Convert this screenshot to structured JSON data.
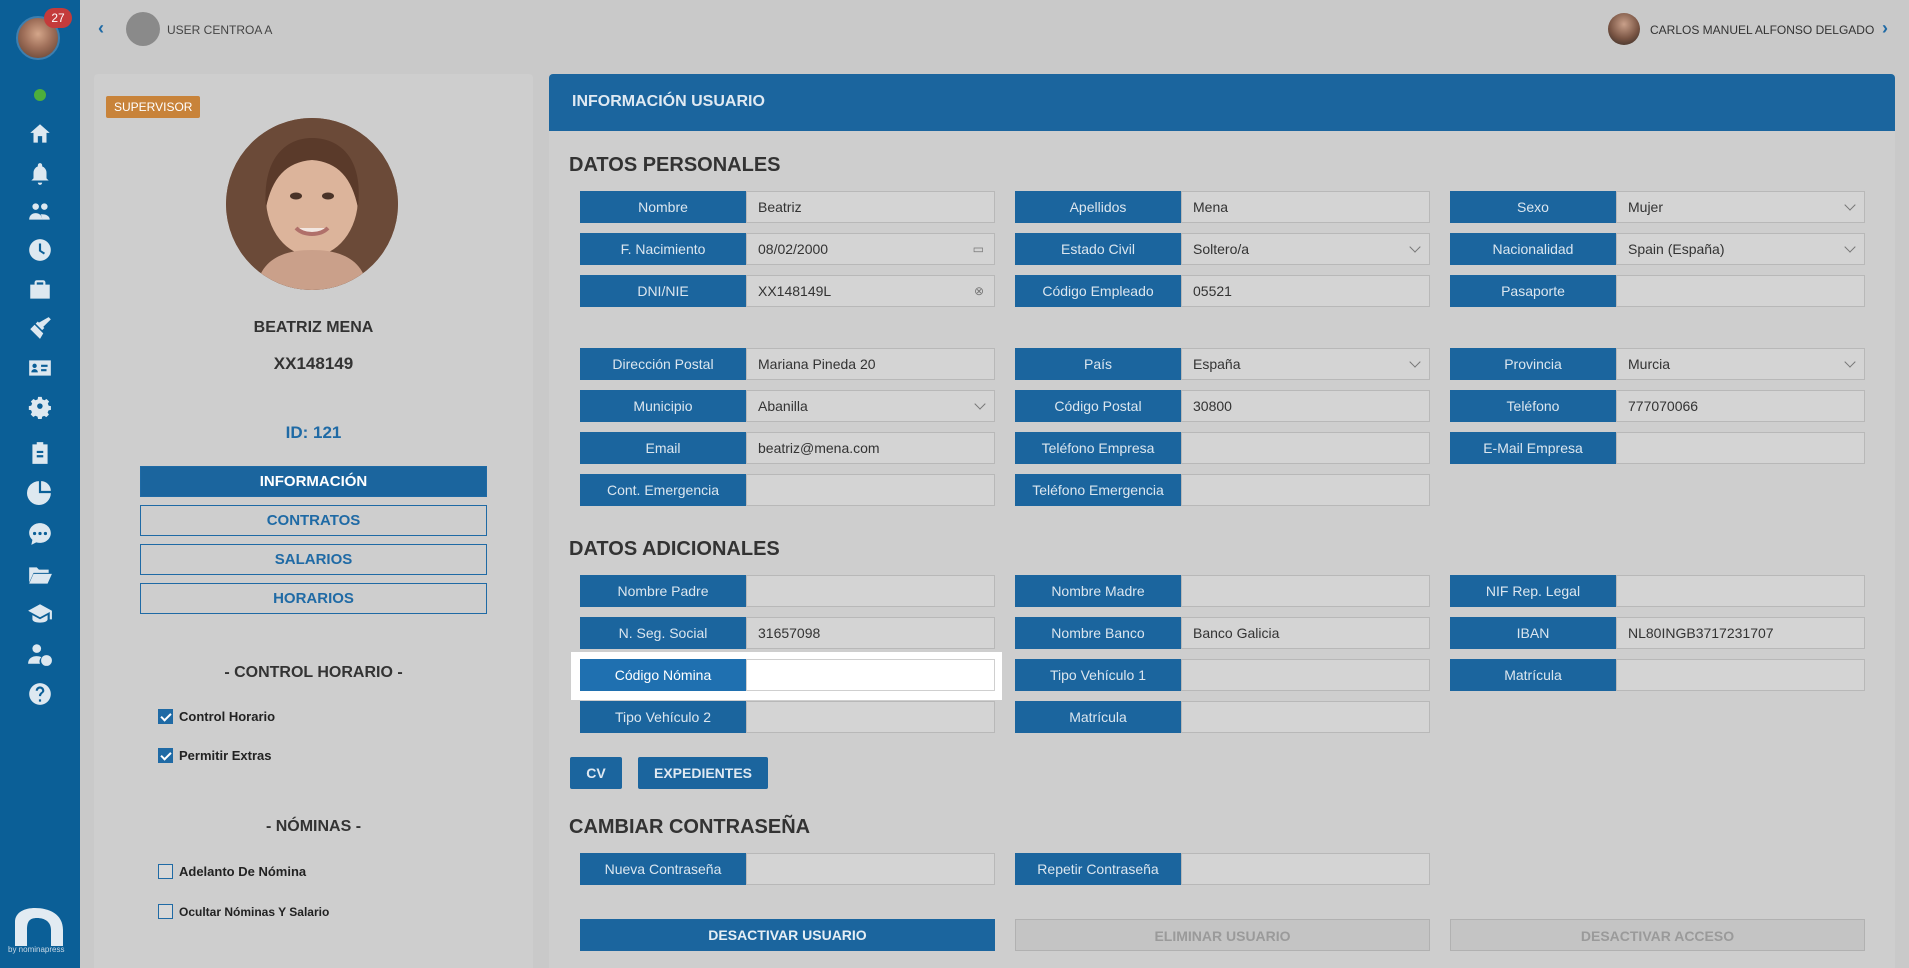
{
  "sidebar": {
    "notification_count": "27",
    "brand_by": "by nominapress",
    "icons": [
      "home-icon",
      "bell-icon",
      "users-icon",
      "clock-icon",
      "briefcase-icon",
      "broom-icon",
      "id-card-icon",
      "gear-icon",
      "clipboard-icon",
      "pie-chart-icon",
      "chat-icon",
      "folder-icon",
      "graduation-cap-icon",
      "user-money-icon",
      "help-icon"
    ]
  },
  "topbar": {
    "centre": "USER CENTROA A",
    "user_name": "CARLOS MANUEL ALFONSO DELGADO"
  },
  "profile": {
    "role_badge": "SUPERVISOR",
    "name": "BEATRIZ MENA",
    "dni": "XX148149",
    "id_label": "ID: 121",
    "nav": [
      "INFORMACIÓN",
      "CONTRATOS",
      "SALARIOS",
      "HORARIOS"
    ],
    "active_nav": "INFORMACIÓN",
    "control_title": "- CONTROL HORARIO -",
    "control_items": [
      {
        "label": "Control Horario",
        "checked": true
      },
      {
        "label": "Permitir Extras",
        "checked": true
      }
    ],
    "nominas_title": "- NÓMINAS -",
    "nominas_items": [
      {
        "label": "Adelanto De Nómina",
        "checked": false
      },
      {
        "label": "Ocultar Nóminas Y Salario",
        "checked": false
      }
    ]
  },
  "main": {
    "header": "INFORMACIÓN USUARIO",
    "personal_title": "DATOS PERSONALES",
    "additional_title": "DATOS ADICIONALES",
    "password_title": "CAMBIAR CONTRASEÑA",
    "fields": {
      "nombre": {
        "label": "Nombre",
        "value": "Beatriz"
      },
      "apellidos": {
        "label": "Apellidos",
        "value": "Mena"
      },
      "sexo": {
        "label": "Sexo",
        "value": "Mujer"
      },
      "nacimiento": {
        "label": "F. Nacimiento",
        "value": "08/02/2000"
      },
      "estado_civil": {
        "label": "Estado Civil",
        "value": "Soltero/a"
      },
      "nacionalidad": {
        "label": "Nacionalidad",
        "value": "Spain (España)"
      },
      "dni": {
        "label": "DNI/NIE",
        "value": "XX148149L"
      },
      "codigo_empleado": {
        "label": "Código Empleado",
        "value": "05521"
      },
      "pasaporte": {
        "label": "Pasaporte",
        "value": ""
      },
      "direccion": {
        "label": "Dirección Postal",
        "value": "Mariana Pineda 20"
      },
      "pais": {
        "label": "País",
        "value": "España"
      },
      "provincia": {
        "label": "Provincia",
        "value": "Murcia"
      },
      "municipio": {
        "label": "Municipio",
        "value": "Abanilla"
      },
      "codigo_postal": {
        "label": "Código Postal",
        "value": "30800"
      },
      "telefono": {
        "label": "Teléfono",
        "value": "777070066"
      },
      "email": {
        "label": "Email",
        "value": "beatriz@mena.com"
      },
      "telefono_empresa": {
        "label": "Teléfono Empresa",
        "value": ""
      },
      "email_empresa": {
        "label": "E-Mail Empresa",
        "value": ""
      },
      "cont_emergencia": {
        "label": "Cont. Emergencia",
        "value": ""
      },
      "telefono_emergencia": {
        "label": "Teléfono Emergencia",
        "value": ""
      },
      "nombre_padre": {
        "label": "Nombre Padre",
        "value": ""
      },
      "nombre_madre": {
        "label": "Nombre Madre",
        "value": ""
      },
      "nif_rep": {
        "label": "NIF Rep. Legal",
        "value": ""
      },
      "seg_social": {
        "label": "N. Seg. Social",
        "value": "31657098"
      },
      "nombre_banco": {
        "label": "Nombre Banco",
        "value": "Banco Galicia"
      },
      "iban": {
        "label": "IBAN",
        "value": "NL80INGB3717231707"
      },
      "codigo_nomina": {
        "label": "Código Nómina",
        "value": ""
      },
      "tipo_vehiculo1": {
        "label": "Tipo Vehículo 1",
        "value": ""
      },
      "matricula1": {
        "label": "Matrícula",
        "value": ""
      },
      "tipo_vehiculo2": {
        "label": "Tipo Vehículo 2",
        "value": ""
      },
      "matricula2": {
        "label": "Matrícula",
        "value": ""
      },
      "nueva_pass": {
        "label": "Nueva Contraseña",
        "value": ""
      },
      "repetir_pass": {
        "label": "Repetir Contraseña",
        "value": ""
      }
    },
    "cv_button": "CV",
    "expedientes_button": "EXPEDIENTES",
    "desactivar_usuario": "DESACTIVAR USUARIO",
    "eliminar_usuario": "ELIMINAR USUARIO",
    "desactivar_acceso": "DESACTIVAR ACCESO"
  },
  "colors": {
    "primary": "#1b659e",
    "sidebar": "#0b5f97",
    "badge": "#c8833a"
  }
}
